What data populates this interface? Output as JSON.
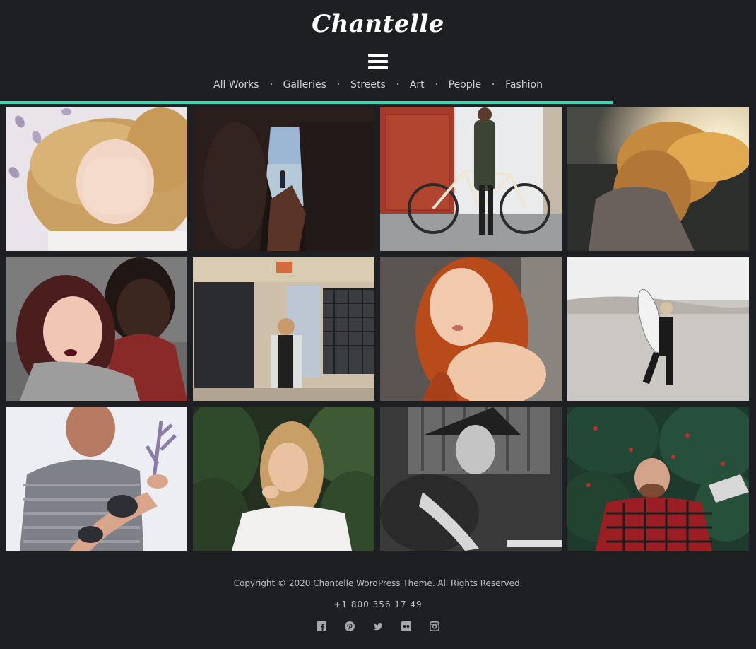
{
  "site": {
    "logo": "Chantelle"
  },
  "nav": {
    "items": [
      "All Works",
      "Galleries",
      "Streets",
      "Art",
      "People",
      "Fashion"
    ]
  },
  "scroll_progress_fraction": 0.81,
  "colors": {
    "background": "#1e1f22",
    "accent": "#35d8b4",
    "text": "#cfd0d2"
  },
  "gallery": {
    "tiles": [
      {
        "name": "woman-covering-eyes"
      },
      {
        "name": "man-in-canyon"
      },
      {
        "name": "woman-with-bicycle"
      },
      {
        "name": "windblown-hair-sunset"
      },
      {
        "name": "two-women-portrait"
      },
      {
        "name": "woman-at-doorway"
      },
      {
        "name": "redhead-portrait"
      },
      {
        "name": "surfer-on-beach"
      },
      {
        "name": "tattooed-man-with-plant"
      },
      {
        "name": "woman-in-jungle"
      },
      {
        "name": "woman-in-black-and-white"
      },
      {
        "name": "man-in-holly-bush"
      }
    ]
  },
  "footer": {
    "copyright": "Copyright © 2020 Chantelle WordPress Theme. All Rights Reserved.",
    "phone": "+1 800 356 17 49",
    "social_icons": [
      "facebook-icon",
      "pinterest-icon",
      "twitter-icon",
      "flickr-icon",
      "instagram-icon"
    ]
  }
}
